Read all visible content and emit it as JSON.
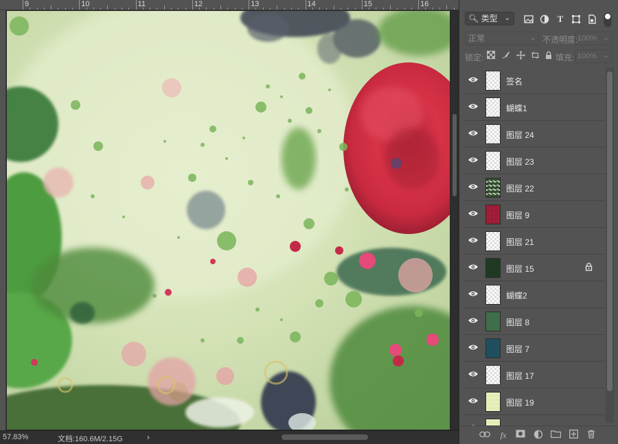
{
  "ruler": {
    "numbers": [
      "9",
      "10",
      "11",
      "12",
      "13",
      "14",
      "15",
      "16"
    ]
  },
  "status": {
    "zoom": "57.83%",
    "doc_size": "文档:160.6M/2.15G",
    "arrow": "›"
  },
  "panel": {
    "filter": {
      "label": "类型",
      "icons": [
        "image-filter-icon",
        "adjustment-filter-icon",
        "type-filter-icon",
        "shape-filter-icon",
        "smart-object-filter-icon"
      ]
    },
    "blend_mode": "正常",
    "opacity_label": "不透明度:",
    "opacity_value": "100%",
    "lock_label": "锁定:",
    "fill_label": "填充:",
    "fill_value": "100%"
  },
  "layers": [
    {
      "name": "签名",
      "thumb": "blank",
      "locked": false
    },
    {
      "name": "蝴蝶1",
      "thumb": "blank",
      "locked": false
    },
    {
      "name": "图层 24",
      "thumb": "blank",
      "locked": false
    },
    {
      "name": "图层 23",
      "thumb": "blank",
      "locked": false
    },
    {
      "name": "图层 22",
      "thumb": "speckle",
      "locked": false
    },
    {
      "name": "图层 9",
      "thumb": "red",
      "locked": false
    },
    {
      "name": "图层 21",
      "thumb": "blank",
      "locked": false
    },
    {
      "name": "图层 15",
      "thumb": "green-dark",
      "locked": true
    },
    {
      "name": "蝴蝶2",
      "thumb": "blank",
      "locked": false
    },
    {
      "name": "图层 8",
      "thumb": "green",
      "locked": false
    },
    {
      "name": "图层 7",
      "thumb": "teal",
      "locked": false
    },
    {
      "name": "图层 17",
      "thumb": "blank",
      "locked": false
    },
    {
      "name": "图层 19",
      "thumb": "yellow",
      "locked": false
    },
    {
      "name": "",
      "thumb": "yellow",
      "locked": false
    }
  ],
  "footer_icons": [
    "link-layers-icon",
    "fx-icon",
    "mask-icon",
    "adjustment-layer-icon",
    "new-group-icon",
    "new-layer-icon",
    "delete-layer-icon"
  ]
}
